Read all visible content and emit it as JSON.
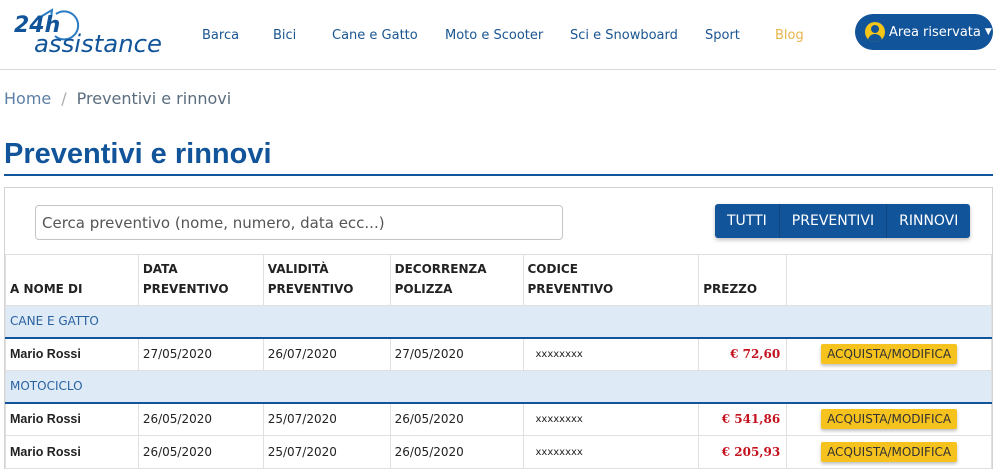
{
  "brand": {
    "name": "24h assistance",
    "logo_text_24h": "24h",
    "logo_text_main": "assistance"
  },
  "nav": [
    {
      "label": "Barca"
    },
    {
      "label": "Bici"
    },
    {
      "label": "Cane e Gatto"
    },
    {
      "label": "Moto e Scooter"
    },
    {
      "label": "Sci e Snowboard"
    },
    {
      "label": "Sport"
    },
    {
      "label": "Blog"
    }
  ],
  "account": {
    "label": "Area riservata",
    "caret": "▼"
  },
  "breadcrumb": {
    "home": "Home",
    "separator": "/",
    "current": "Preventivi e rinnovi"
  },
  "page": {
    "title": "Preventivi e rinnovi"
  },
  "search": {
    "placeholder": "Cerca preventivo (nome, numero, data ecc...)"
  },
  "filters": [
    {
      "label": "TUTTI"
    },
    {
      "label": "PREVENTIVI"
    },
    {
      "label": "RINNOVI"
    }
  ],
  "table": {
    "headers": [
      [
        "A NOME DI"
      ],
      [
        "DATA",
        "PREVENTIVO"
      ],
      [
        "VALIDITÀ",
        "PREVENTIVO"
      ],
      [
        "DECORRENZA",
        "POLIZZA"
      ],
      [
        "CODICE",
        "PREVENTIVO"
      ],
      [
        "PREZZO"
      ],
      [
        ""
      ]
    ],
    "groups": [
      {
        "label": "CANE E GATTO",
        "rows": [
          {
            "name": "Mario Rossi",
            "data": "27/05/2020",
            "validita": "26/07/2020",
            "decorrenza": "27/05/2020",
            "codice": "xxxxxxxx",
            "prezzo": "€ 72,60",
            "action": "ACQUISTA/MODIFICA"
          }
        ]
      },
      {
        "label": "MOTOCICLO",
        "rows": [
          {
            "name": "Mario Rossi",
            "data": "26/05/2020",
            "validita": "25/07/2020",
            "decorrenza": "26/05/2020",
            "codice": "xxxxxxxx",
            "prezzo": "€ 541,86",
            "action": "ACQUISTA/MODIFICA"
          },
          {
            "name": "Mario Rossi",
            "data": "26/05/2020",
            "validita": "25/07/2020",
            "decorrenza": "26/05/2020",
            "codice": "xxxxxxxx",
            "prezzo": "€ 205,93",
            "action": "ACQUISTA/MODIFICA"
          }
        ]
      }
    ]
  },
  "colors": {
    "brand_blue": "#12549a",
    "accent_yellow": "#f6c21e",
    "price_red": "#c4121f",
    "group_bg": "#deeaf6",
    "blog_gold": "#e6b54a"
  }
}
